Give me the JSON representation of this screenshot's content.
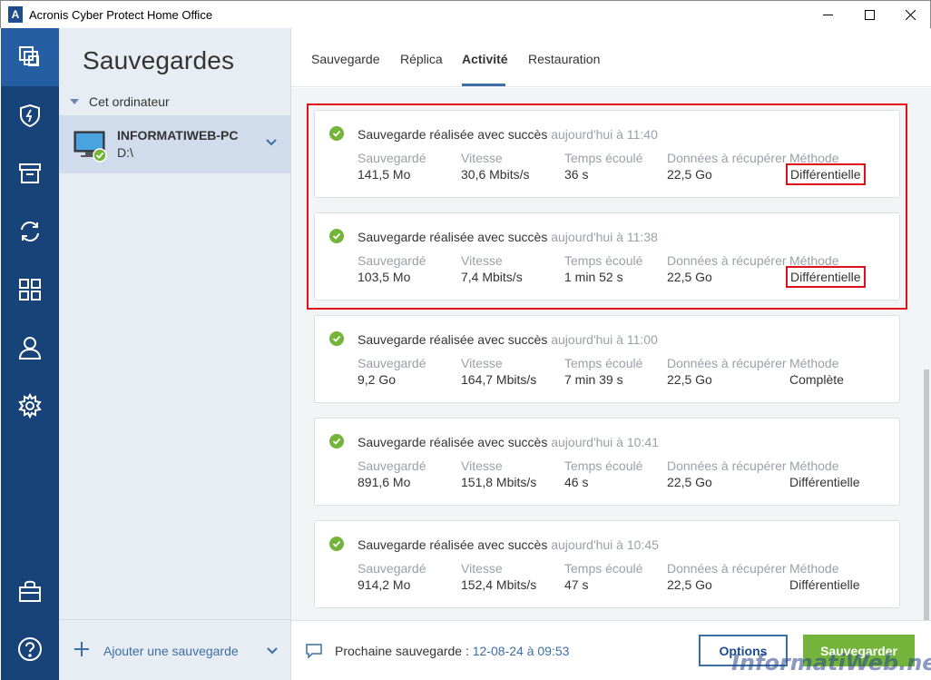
{
  "window": {
    "logo_letter": "A",
    "title": "Acronis Cyber Protect Home Office"
  },
  "rail": {
    "items": [
      {
        "icon": "backup-icon",
        "active": true
      },
      {
        "icon": "shield-icon",
        "active": false
      },
      {
        "icon": "archive-icon",
        "active": false
      },
      {
        "icon": "sync-icon",
        "active": false
      },
      {
        "icon": "grid-icon",
        "active": false
      },
      {
        "icon": "account-icon",
        "active": false
      },
      {
        "icon": "gear-icon",
        "active": false
      },
      {
        "icon": "store-icon",
        "active": false
      },
      {
        "icon": "help-icon",
        "active": false
      }
    ]
  },
  "sidebar": {
    "title": "Sauvegardes",
    "section": "Cet ordinateur",
    "backup_name": "INFORMATIWEB-PC",
    "backup_drive": "D:\\",
    "add_label": "Ajouter une sauvegarde"
  },
  "tabs": [
    "Sauvegarde",
    "Réplica",
    "Activité",
    "Restauration"
  ],
  "active_tab": "Activité",
  "activity": {
    "labels": {
      "saved": "Sauvegardé",
      "speed": "Vitesse",
      "elapsed": "Temps écoulé",
      "recover": "Données à récupérer",
      "method": "Méthode"
    },
    "entries": [
      {
        "status": "Sauvegarde réalisée avec succès",
        "time": "aujourd'hui à 11:40",
        "saved": "141,5 Mo",
        "speed": "30,6 Mbits/s",
        "elapsed": "36 s",
        "recover": "22,5 Go",
        "method": "Différentielle"
      },
      {
        "status": "Sauvegarde réalisée avec succès",
        "time": "aujourd'hui à 11:38",
        "saved": "103,5 Mo",
        "speed": "7,4 Mbits/s",
        "elapsed": "1 min 52 s",
        "recover": "22,5 Go",
        "method": "Différentielle"
      },
      {
        "status": "Sauvegarde réalisée avec succès",
        "time": "aujourd'hui à 11:00",
        "saved": "9,2 Go",
        "speed": "164,7 Mbits/s",
        "elapsed": "7 min 39 s",
        "recover": "22,5 Go",
        "method": "Complète"
      },
      {
        "status": "Sauvegarde réalisée avec succès",
        "time": "aujourd'hui à 10:41",
        "saved": "891,6 Mo",
        "speed": "151,8 Mbits/s",
        "elapsed": "46 s",
        "recover": "22,5 Go",
        "method": "Différentielle"
      },
      {
        "status": "Sauvegarde réalisée avec succès",
        "time": "aujourd'hui à 10:45",
        "saved": "914,2 Mo",
        "speed": "152,4 Mbits/s",
        "elapsed": "47 s",
        "recover": "22,5 Go",
        "method": "Différentielle"
      }
    ]
  },
  "footer": {
    "next_label": "Prochaine sauvegarde :",
    "next_value": "12-08-24 à 09:53",
    "options_label": "Options",
    "save_label": "Sauvegarder"
  },
  "watermark": "InformatiWeb.net",
  "colors": {
    "rail": "#174379",
    "rail_active": "#255ea3",
    "accent": "#3d6ea6",
    "success": "#75b43a",
    "annotation": "#e0101a"
  }
}
